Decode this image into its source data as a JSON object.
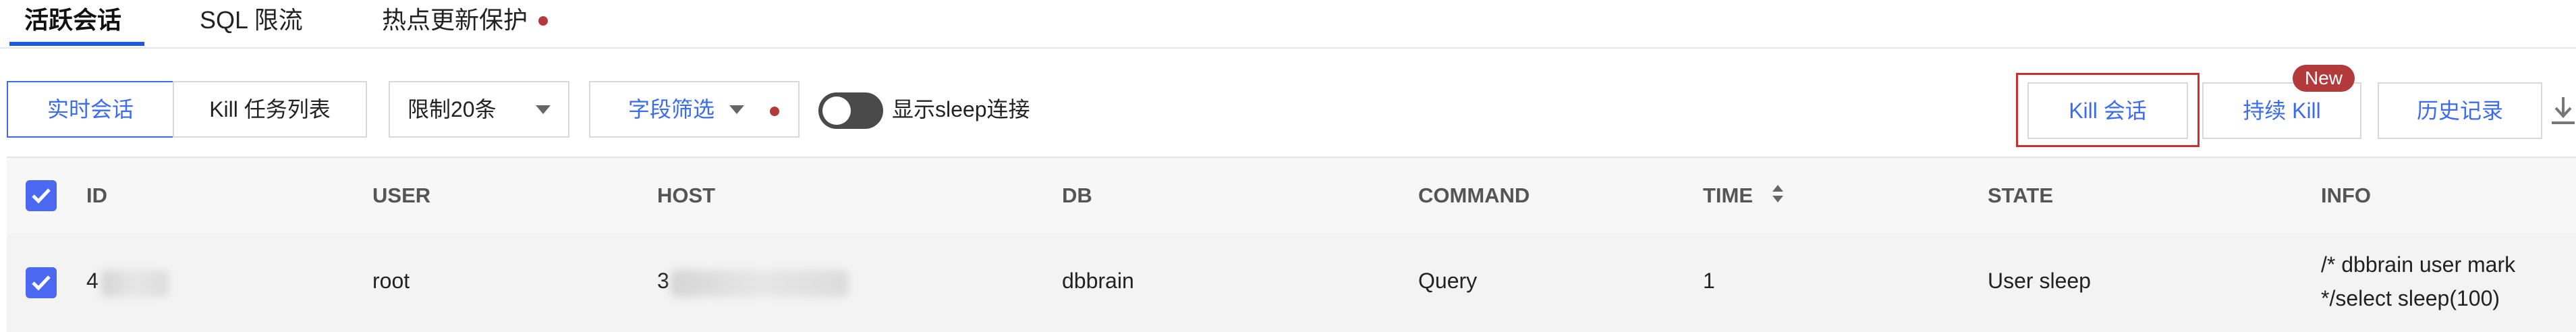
{
  "tabs": [
    {
      "label": "活跃会话",
      "active": true
    },
    {
      "label": "SQL 限流",
      "active": false
    },
    {
      "label": "热点更新保护",
      "active": false,
      "has_dot": true
    }
  ],
  "toolbar": {
    "realtime_label": "实时会话",
    "kill_list_label": "Kill 任务列表",
    "limit_select": "限制20条",
    "field_filter": "字段筛选",
    "sleep_toggle_label": "显示sleep连接",
    "kill_session_label": "Kill 会话",
    "continuous_kill_label": "持续 Kill",
    "new_badge": "New",
    "history_label": "历史记录"
  },
  "table": {
    "columns": [
      "ID",
      "USER",
      "HOST",
      "DB",
      "COMMAND",
      "TIME",
      "STATE",
      "INFO"
    ],
    "rows": [
      {
        "id": "4",
        "user": "root",
        "host": "3",
        "db": "dbbrain",
        "command": "Query",
        "time": "1",
        "state": "User sleep",
        "info_line1": "/* dbbrain user mark",
        "info_line2": "*/select sleep(100)"
      }
    ]
  },
  "colors": {
    "accent": "#3b6cf0",
    "checkbox": "#4a68f0",
    "badge": "#b33a3a",
    "highlight_border": "#cc2f2f",
    "toggle_off": "#4a4a4a"
  }
}
